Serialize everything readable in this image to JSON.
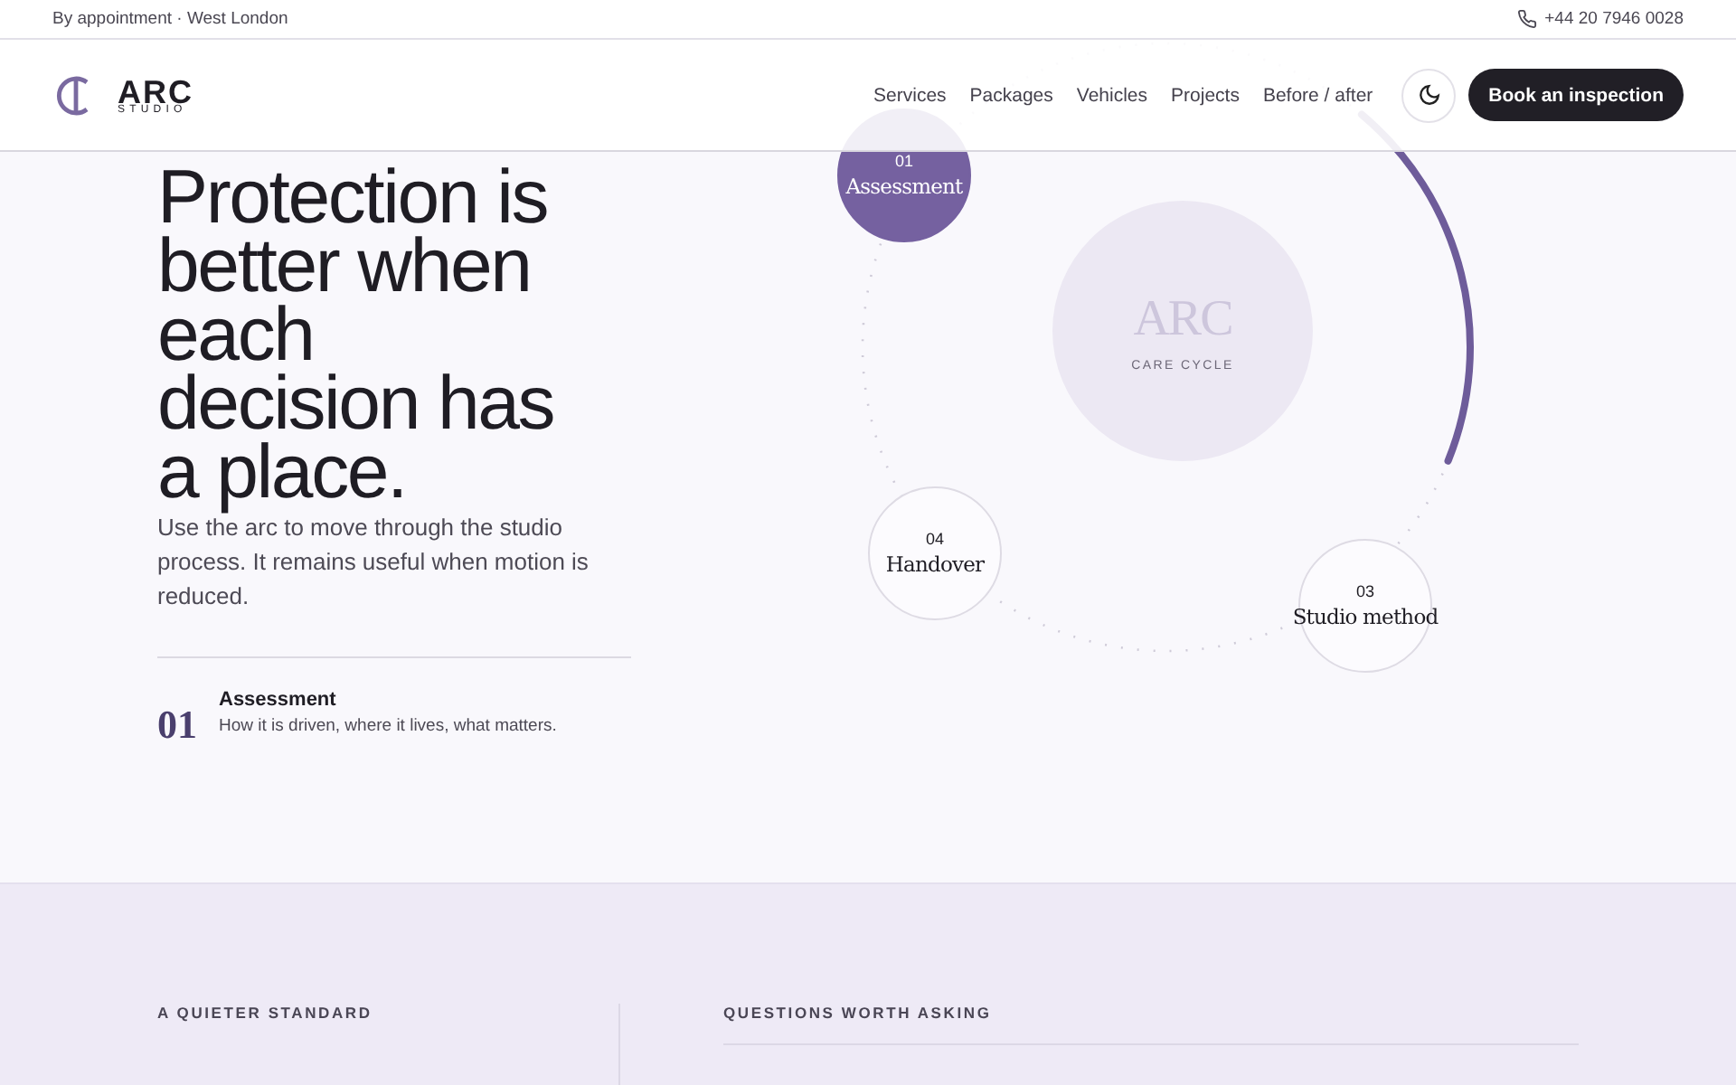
{
  "topbar": {
    "location": "By appointment · West London",
    "phone": "+44 20 7946 0028"
  },
  "header": {
    "logo": {
      "name": "ARC",
      "tagline": "STUDIO"
    },
    "nav": [
      {
        "label": "Services"
      },
      {
        "label": "Packages"
      },
      {
        "label": "Vehicles"
      },
      {
        "label": "Projects"
      },
      {
        "label": "Before / after"
      }
    ],
    "cta": "Book an inspection"
  },
  "hero": {
    "heading": "Protection is better when each decision has a place.",
    "intro": "Use the arc to move through the studio process. It remains useful when motion is reduced.",
    "step": {
      "number": "01",
      "title": "Assessment",
      "description": "How it is driven, where it lives, what matters."
    }
  },
  "cycle": {
    "center_title": "ARC",
    "center_caption": "CARE CYCLE",
    "steps": [
      {
        "number": "01",
        "label": "Assessment",
        "selected": true
      },
      {
        "number": "04",
        "label": "Handover",
        "selected": false
      },
      {
        "number": "03",
        "label": "Studio method",
        "selected": false
      }
    ]
  },
  "lower": {
    "left_label": "A QUIETER STANDARD",
    "right_label": "QUESTIONS WORTH ASKING"
  }
}
